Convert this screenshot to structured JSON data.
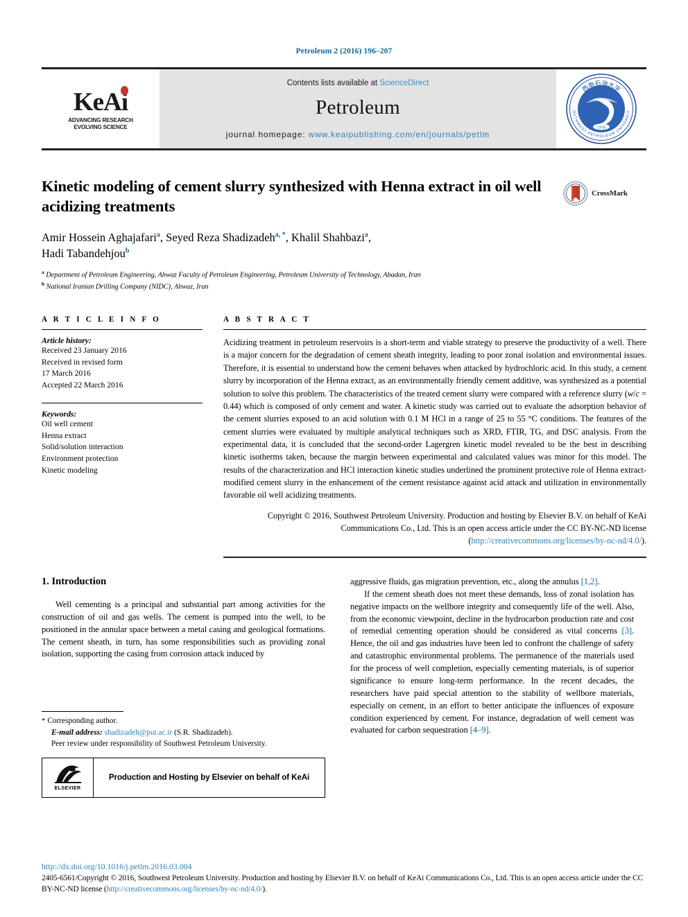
{
  "running_head": "Petroleum 2 (2016) 196–207",
  "header": {
    "keai": {
      "wordmark": "KeAi",
      "tagline_line1": "ADVANCING RESEARCH",
      "tagline_line2": "EVOLVING SCIENCE"
    },
    "contents_prefix": "Contents lists available at ",
    "contents_link": "ScienceDirect",
    "journal_title": "Petroleum",
    "homepage_label": "journal homepage: ",
    "homepage_url": "www.keaipublishing.com/en/journals/petlm",
    "seal": {
      "outer_text_top": "西南石油大学",
      "outer_text_bottom": "SOUTHWEST PETROLEUM UNIVERSITY",
      "year": "1958"
    }
  },
  "title": "Kinetic modeling of cement slurry synthesized with Henna extract in oil well acidizing treatments",
  "crossmark_label": "CrossMark",
  "authors": {
    "line1_a": "Amir Hossein Aghajafari",
    "sup1": "a",
    "line1_b": ", Seyed Reza Shadizadeh",
    "sup2": "a, *",
    "line1_c": ", Khalil Shahbazi",
    "sup3": "a",
    "line1_d": ",",
    "line2": "Hadi Tabandehjou",
    "sup4": "b"
  },
  "affiliations": [
    {
      "mark": "a",
      "text": "Department of Petroleum Engineering, Ahwaz Faculty of Petroleum Engineering, Petroleum University of Technology, Abadan, Iran"
    },
    {
      "mark": "b",
      "text": "National Iranian Drilling Company (NIDC), Ahwaz, Iran"
    }
  ],
  "article_info": {
    "heading": "A R T I C L E   I N F O",
    "history_label": "Article history:",
    "history_lines": [
      "Received 23 January 2016",
      "Received in revised form",
      "17 March 2016",
      "Accepted 22 March 2016"
    ],
    "keywords_label": "Keywords:",
    "keywords": [
      "Oil well cement",
      "Henna extract",
      "Solid/solution interaction",
      "Environment protection",
      "Kinetic modeling"
    ]
  },
  "abstract": {
    "heading": "A B S T R A C T",
    "part1": "Acidizing treatment in petroleum reservoirs is a short-term and viable strategy to preserve the productivity of a well. There is a major concern for the degradation of cement sheath integrity, leading to poor zonal isolation and environmental issues. Therefore, it is essential to understand how the cement behaves when attacked by hydrochloric acid. In this study, a cement slurry by incorporation of the Henna extract, as an environmentally friendly cement additive, was synthesized as a potential solution to solve this problem. The characteristics of the treated cement slurry were compared with a reference slurry (",
    "wc_italic_w": "w",
    "wc_slash": "/",
    "wc_italic_c": "c",
    "wc_value": " = 0.44",
    "part2": ") which is composed of only cement and water. A kinetic study was carried out to evaluate the adsorption behavior of the cement slurries exposed to an acid solution with 0.1 M HCl in a range of 25 to 55 °C conditions. The features of the cement slurries were evaluated by multiple analytical techniques such as XRD, FTIR, TG, and DSC analysis. From the experimental data, it is concluded that the second-order Lagergren kinetic model revealed to be the best in describing kinetic isotherms taken, because the margin between experimental and calculated values was minor for this model. The results of the characterization and HCl interaction kinetic studies underlined the prominent protective role of Henna extract-modified cement slurry in the enhancement of the cement resistance against acid attack and utilization in environmentally favorable oil well acidizing treatments.",
    "copyright_text": "Copyright © 2016, Southwest Petroleum University. Production and hosting by Elsevier B.V. on behalf of KeAi Communications Co., Ltd. This is an open access article under the CC BY-NC-ND license (",
    "copyright_link": "http://creativecommons.org/licenses/by-nc-nd/4.0/",
    "copyright_tail": ")."
  },
  "introduction": {
    "heading": "1. Introduction",
    "left_p1": "Well cementing is a principal and substantial part among activities for the construction of oil and gas wells. The cement is pumped into the well, to be positioned in the annular space between a metal casing and geological formations. The cement sheath, in turn, has some responsibilities such as providing zonal isolation, supporting the casing from corrosion attack induced by",
    "right_p1_cont": "aggressive fluids, gas migration prevention, etc., along the annulus ",
    "right_p1_ref": "[1,2]",
    "right_p1_tail": ".",
    "right_p2_a": "If the cement sheath does not meet these demands, loss of zonal isolation has negative impacts on the wellbore integrity and consequently life of the well. Also, from the economic viewpoint, decline in the hydrocarbon production rate and cost of remedial cementing operation should be considered as vital concerns ",
    "right_p2_ref1": "[3]",
    "right_p2_b": ". Hence, the oil and gas industries have been led to confront the challenge of safety and catastrophic environmental problems. The permanence of the materials used for the process of well completion, especially cementing materials, is of superior significance to ensure long-term performance. In the recent decades, the researchers have paid special attention to the stability of wellbore materials, especially on cement, in an effort to better anticipate the influences of exposure condition experienced by cement. For instance, degradation of well cement was evaluated for carbon sequestration ",
    "right_p2_ref2": "[4–9]",
    "right_p2_tail": "."
  },
  "footnote": {
    "star": "*",
    "corresponding": "Corresponding author.",
    "email_label": "E-mail address:",
    "email": "shadizadeh@put.ac.ir",
    "email_tail": " (S.R. Shadizadeh).",
    "peer_review": "Peer review under responsibility of Southwest Petroleum University.",
    "elsevier_word": "ELSEVIER",
    "production_caption": "Production and Hosting by Elsevier on behalf of KeAi"
  },
  "page_footer": {
    "doi": "http://dx.doi.org/10.1016/j.petlm.2016.03.004",
    "issn_text": "2405-6561/Copyright © 2016, Southwest Petroleum University. Production and hosting by Elsevier B.V. on behalf of KeAi Communications Co., Ltd. This is an open access article under the CC BY-NC-ND license (",
    "issn_link": "http://creativecommons.org/licenses/by-nc-nd/4.0/",
    "issn_tail": ")."
  },
  "colors": {
    "link_blue": "#2c7fb8",
    "ref_blue": "#0a6a9a",
    "band_gray": "#e3e3e3",
    "keai_red": "#c0392b",
    "seal_blue": "#1f4e9c"
  }
}
